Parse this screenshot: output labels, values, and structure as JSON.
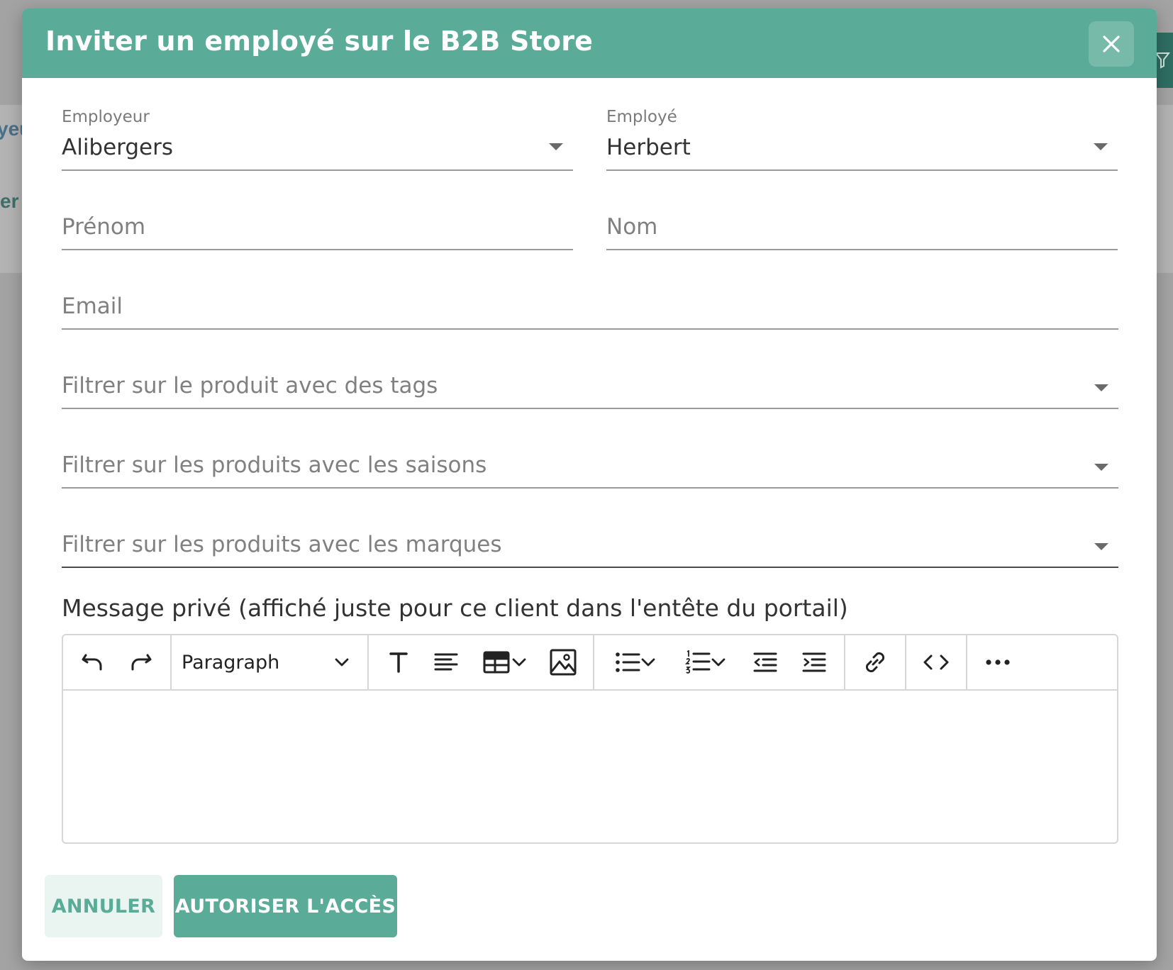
{
  "background": {
    "fragment_1": "yeu",
    "fragment_2": "er"
  },
  "modal": {
    "title": "Inviter un employé sur le B2B Store",
    "close_icon": "close-icon"
  },
  "form": {
    "employer": {
      "label": "Employeur",
      "value": "Alibergers"
    },
    "employee": {
      "label": "Employé",
      "value": "Herbert"
    },
    "first_name": {
      "placeholder": "Prénom",
      "value": ""
    },
    "last_name": {
      "placeholder": "Nom",
      "value": ""
    },
    "email": {
      "placeholder": "Email",
      "value": ""
    },
    "tags_filter": {
      "placeholder": "Filtrer sur le produit avec des tags"
    },
    "seasons_filter": {
      "placeholder": "Filtrer sur les produits avec les saisons"
    },
    "brands_filter": {
      "placeholder": "Filtrer sur les produits avec les marques"
    },
    "private_message_label": "Message privé (affiché juste pour ce client dans l'entête du portail)"
  },
  "editor": {
    "block_format": "Paragraph",
    "toolbar_icons": [
      "undo-icon",
      "redo-icon",
      "chevron-down-icon",
      "text-format-icon",
      "align-left-icon",
      "table-icon",
      "image-icon",
      "bullet-list-icon",
      "numbered-list-icon",
      "outdent-icon",
      "indent-icon",
      "link-icon",
      "code-icon",
      "more-icon"
    ],
    "content": ""
  },
  "actions": {
    "cancel_label": "ANNULER",
    "submit_label": "AUTORISER L'ACCÈS"
  },
  "colors": {
    "accent": "#5aab98",
    "accent_light": "#eaf4f1",
    "overlay": "#a3a3a3"
  }
}
